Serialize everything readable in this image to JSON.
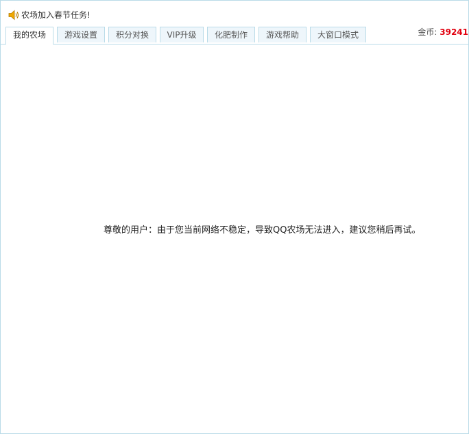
{
  "announcement": {
    "icon": "speaker-icon",
    "text": "农场加入春节任务!"
  },
  "tabs": [
    {
      "label": "我的农场",
      "active": true
    },
    {
      "label": "游戏设置",
      "active": false
    },
    {
      "label": "积分对换",
      "active": false
    },
    {
      "label": "VIP升级",
      "active": false
    },
    {
      "label": "化肥制作",
      "active": false
    },
    {
      "label": "游戏帮助",
      "active": false
    },
    {
      "label": "大窗口模式",
      "active": false
    }
  ],
  "gold": {
    "label": "金币:",
    "value": "39241"
  },
  "message": "尊敬的用户：由于您当前网络不稳定，导致QQ农场无法进入，建议您稍后再试。",
  "colors": {
    "border": "#b9dbe8",
    "tab_bg": "#eef6fb",
    "gold_value": "#e1000f",
    "speaker": "#f0a800"
  }
}
